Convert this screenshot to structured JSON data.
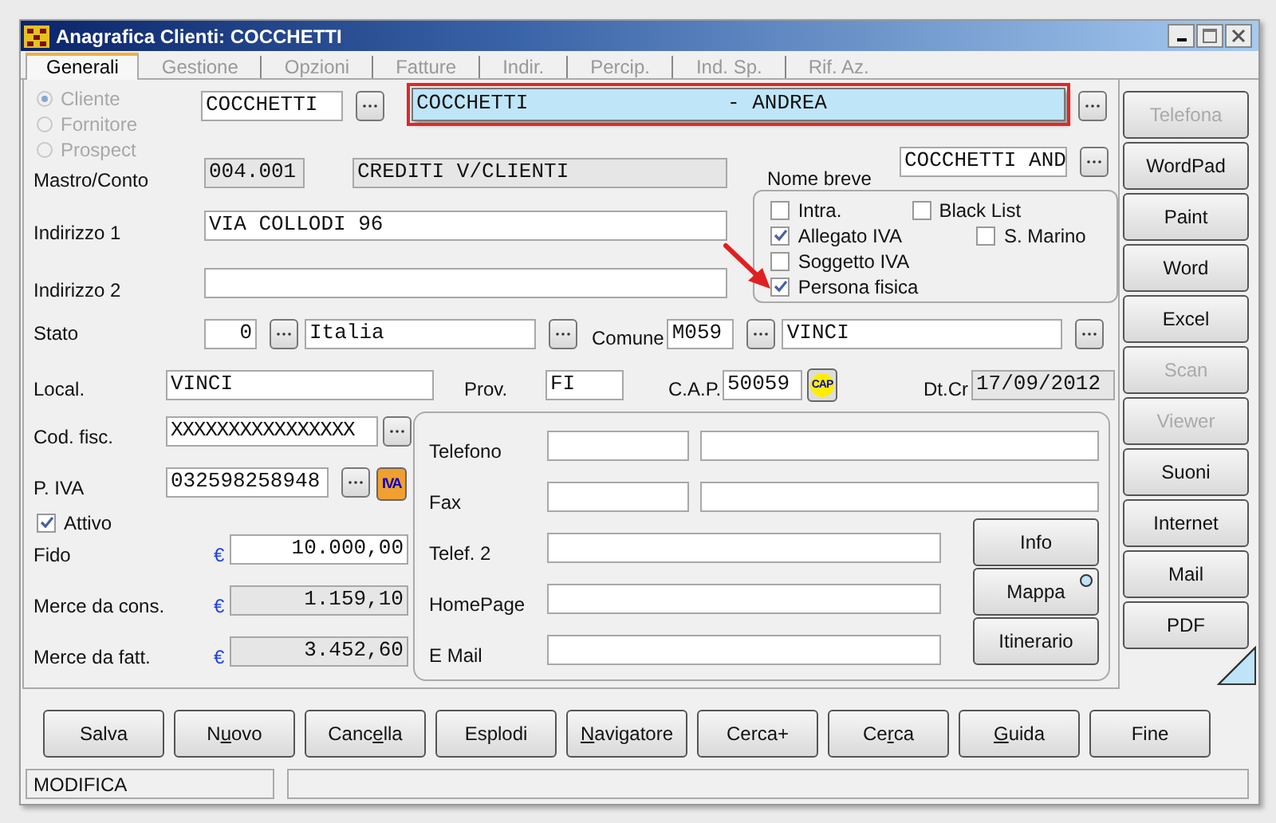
{
  "window": {
    "title": "Anagrafica Clienti: COCCHETTI"
  },
  "tabs": [
    {
      "label": "Generali",
      "selected": true
    },
    {
      "label": "Gestione",
      "selected": false
    },
    {
      "label": "Opzioni",
      "selected": false
    },
    {
      "label": "Fatture",
      "selected": false
    },
    {
      "label": "Indir.",
      "selected": false
    },
    {
      "label": "Percip.",
      "selected": false
    },
    {
      "label": "Ind. Sp.",
      "selected": false
    },
    {
      "label": "Rif. Az.",
      "selected": false
    }
  ],
  "type_radios": [
    {
      "label": "Cliente",
      "selected": true,
      "disabled": true
    },
    {
      "label": "Fornitore",
      "selected": false,
      "disabled": true
    },
    {
      "label": "Prospect",
      "selected": false,
      "disabled": true
    }
  ],
  "code_field": {
    "value": "COCCHETTI"
  },
  "ragione_sociale": {
    "value": "COCCHETTI                - ANDREA",
    "highlighted": true
  },
  "mastro": {
    "label": "Mastro/Conto",
    "code": "004.001",
    "description": "CREDITI V/CLIENTI"
  },
  "nome_breve": {
    "label": "Nome breve",
    "value": "COCCHETTI AND"
  },
  "flag_rows": [
    {
      "items": [
        {
          "label": "Intra.",
          "checked": false
        },
        {
          "label": "Black List",
          "checked": false
        }
      ]
    },
    {
      "items": [
        {
          "label": "Allegato IVA",
          "checked": true
        },
        {
          "label": "S. Marino",
          "checked": false
        }
      ]
    },
    {
      "items": [
        {
          "label": "Soggetto IVA",
          "checked": false
        }
      ]
    },
    {
      "items": [
        {
          "label": "Persona fisica",
          "checked": true
        }
      ]
    }
  ],
  "indirizzo": [
    {
      "label": "Indirizzo 1",
      "value": "VIA COLLODI 96"
    },
    {
      "label": "Indirizzo 2"
    }
  ],
  "stato": {
    "label": "Stato",
    "code": "0",
    "name": "Italia"
  },
  "comune": {
    "label": "Comune",
    "code": "M059",
    "name": "VINCI"
  },
  "localita": {
    "label": "Local.",
    "value": "VINCI"
  },
  "provincia": {
    "label": "Prov.",
    "value": "FI"
  },
  "cap": {
    "label": "C.A.P.",
    "value": "50059",
    "button": "CAP"
  },
  "data_creazione": {
    "label": "Dt.Cr",
    "value": "17/09/2012"
  },
  "codice_fiscale": {
    "label": "Cod. fisc.",
    "value": "XXXXXXXXXXXXXXXX"
  },
  "partita_iva": {
    "label": "P. IVA",
    "value": "032598258948",
    "button": "IVA"
  },
  "attivo": {
    "label": "Attivo",
    "checked": true
  },
  "amounts": [
    {
      "label": "Fido",
      "currency": "€",
      "value": "10.000,00",
      "readonly": false
    },
    {
      "label": "Merce da cons.",
      "currency": "€",
      "value": "1.159,10",
      "readonly": true
    },
    {
      "label": "Merce da fatt.",
      "currency": "€",
      "value": "3.452,60",
      "readonly": true
    }
  ],
  "contacts": [
    {
      "label": "Telefono",
      "kind": "double"
    },
    {
      "label": "Fax",
      "kind": "double"
    },
    {
      "label": "Telef. 2",
      "kind": "single"
    },
    {
      "label": "HomePage",
      "kind": "single"
    },
    {
      "label": "E Mail",
      "kind": "single"
    }
  ],
  "contact_buttons": [
    {
      "label": "Info",
      "indicator": false
    },
    {
      "label": "Mappa",
      "indicator": true
    },
    {
      "label": "Itinerario",
      "indicator": false
    }
  ],
  "side_buttons": [
    {
      "label": "Telefona",
      "disabled": true
    },
    {
      "label": "WordPad",
      "disabled": false
    },
    {
      "label": "Paint",
      "disabled": false
    },
    {
      "label": "Word",
      "disabled": false
    },
    {
      "label": "Excel",
      "disabled": false
    },
    {
      "label": "Scan",
      "disabled": true
    },
    {
      "label": "Viewer",
      "disabled": true
    },
    {
      "label": "Suoni",
      "disabled": false
    },
    {
      "label": "Internet",
      "disabled": false
    },
    {
      "label": "Mail",
      "disabled": false
    },
    {
      "label": "PDF",
      "disabled": false
    }
  ],
  "bottom_buttons": [
    {
      "label": "Salva"
    },
    {
      "label": "N",
      "access_key": "u",
      "label_end": "ovo"
    },
    {
      "label": "Canc",
      "access_key": "e",
      "label_end": "lla"
    },
    {
      "label": "Esplodi"
    },
    {
      "access_key": "N",
      "label_end": "avigatore"
    },
    {
      "label": "Cerca+"
    },
    {
      "label": "Ce",
      "access_key": "r",
      "label_end": "ca"
    },
    {
      "access_key": "G",
      "label_end": "uida"
    },
    {
      "label": "Fine"
    }
  ],
  "status_bar": {
    "mode": "MODIFICA"
  }
}
